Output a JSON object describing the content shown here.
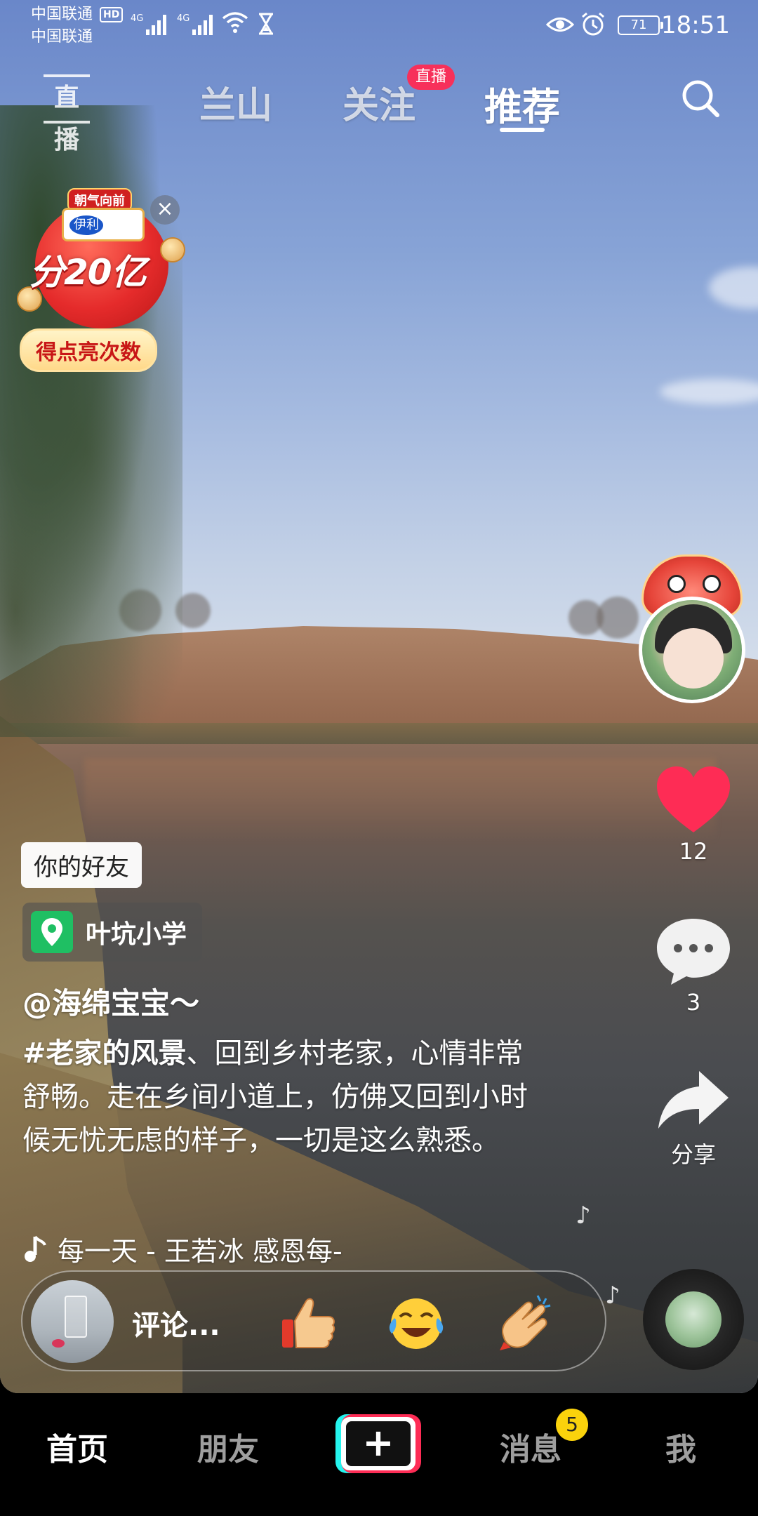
{
  "status_bar": {
    "carrier_1": "中国联通",
    "hd_badge": "HD",
    "carrier_2": "中国联通",
    "network_1": "4G",
    "network_2": "4G",
    "battery": "71",
    "time": "18:51"
  },
  "top_nav": {
    "live_label": "直播",
    "tabs": [
      {
        "label": "兰山"
      },
      {
        "label": "关注"
      },
      {
        "label": "推荐"
      }
    ],
    "active_tab": "推荐",
    "follow_badge": "直播"
  },
  "promo": {
    "slogan": "朝气向前",
    "brand": "伊利",
    "main": "分20亿",
    "cta": "得点亮次数"
  },
  "video": {
    "friend_tag": "你的好友",
    "location": "叶坑小学",
    "author": "@海绵宝宝～",
    "hashtag": "#老家的风景",
    "caption": "、回到乡村老家，心情非常舒畅。走在乡间小道上，仿佛又回到小时候无忧无虑的样子，一切是这么熟悉。",
    "music": "每一天 - 王若冰    感恩每-"
  },
  "actions": {
    "likes": "12",
    "comments": "3",
    "share_label": "分享"
  },
  "comment_bar": {
    "placeholder": "评论..."
  },
  "bottom_nav": {
    "home": "首页",
    "friends": "朋友",
    "plus": "+",
    "messages": "消息",
    "messages_badge": "5",
    "me": "我"
  },
  "colors": {
    "like_red": "#fe2c55",
    "live_pink": "#f7305a",
    "location_green": "#1fbf63",
    "badge_yellow": "#fad20c"
  },
  "icons": [
    "signal-icon",
    "wifi-icon",
    "hourglass-icon",
    "eye-icon",
    "alarm-icon",
    "search-icon",
    "heart-icon",
    "comment-icon",
    "share-icon",
    "location-pin-icon",
    "music-note-icon",
    "thumbs-up-emoji",
    "laugh-cry-emoji",
    "clap-emoji"
  ]
}
